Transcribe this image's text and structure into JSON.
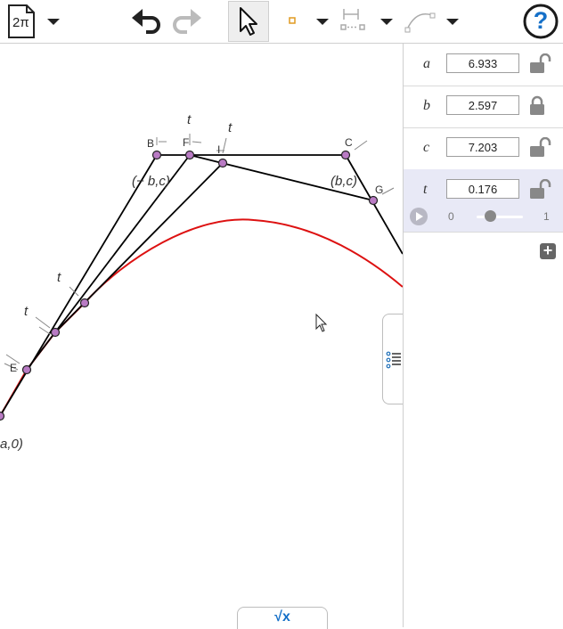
{
  "toolbar": {
    "app_icon_label": "2π",
    "icons": [
      "page-icon",
      "dropdown-icon",
      "undo-icon",
      "redo-icon",
      "move-tool-icon",
      "point-tool-icon",
      "measure-tool-icon",
      "curve-tool-icon",
      "help-icon"
    ],
    "help_label": "?"
  },
  "canvas": {
    "labels": {
      "B": "B",
      "F": "F",
      "I": "I",
      "C": "C",
      "G": "G",
      "E": "E",
      "t1": "t",
      "t2": "t",
      "t3": "t",
      "t4": "t",
      "neg_b_c": "(− b,c)",
      "b_c": "(b,c)",
      "a_0": "a,0)"
    },
    "colors": {
      "curve": "#dd1111",
      "lines": "#000000",
      "points": "#b97bc4"
    }
  },
  "panel": {
    "params": [
      {
        "name": "a",
        "value": "6.933",
        "locked": false
      },
      {
        "name": "b",
        "value": "2.597",
        "locked": true
      },
      {
        "name": "c",
        "value": "7.203",
        "locked": false
      },
      {
        "name": "t",
        "value": "0.176",
        "locked": false
      }
    ],
    "slider": {
      "min": "0",
      "max": "1",
      "fraction": 0.176
    },
    "add_label": "+"
  },
  "bottom_tab": {
    "label": "√x"
  }
}
